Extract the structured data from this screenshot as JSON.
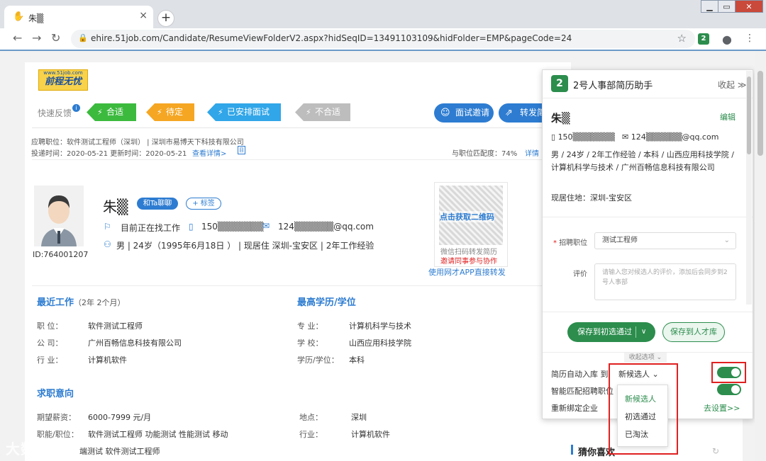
{
  "browser": {
    "tab_title": "朱▒",
    "url": "ehire.51job.com/Candidate/ResumeViewFolderV2.aspx?hidSeqID=13491103109&hidFolder=EMP&pageCode=24",
    "extension_badge": "2"
  },
  "page": {
    "logo": {
      "url_text": "www.51job.com",
      "brand": "前程无忧"
    },
    "quick_feedback": {
      "label": "快速反馈",
      "buttons": [
        "合适",
        "待定",
        "已安排面试",
        "不合适"
      ],
      "colors": [
        "#3cba3e",
        "#f5a623",
        "#31a6e8",
        "#bdbdbd"
      ]
    },
    "actions": {
      "invite": "面试邀请",
      "forward": "转发简"
    },
    "meta": {
      "applied": "应聘职位：软件测试工程师（深圳）  |  深圳市易博天下科技有限公司",
      "posted": "投递时间：2020-05-21    更新时间：2020-05-21",
      "detail_link": "查看详情>",
      "match": "与职位匹配度：74%",
      "match_detail": "详情"
    },
    "candidate": {
      "name": "朱▒",
      "chat": "和Ta聊聊",
      "tag": "+ 标签",
      "id": "ID:764001207",
      "status": "目前正在找工作",
      "phone": "150▒▒▒▒▒▒▒",
      "email": "124▒▒▒▒▒▒@qq.com",
      "info": "男 | 24岁（1995年6月18日 ）  | 现居住 深圳-宝安区 | 2年工作经验"
    },
    "qr": {
      "get": "点击获取二维码",
      "line1": "微信扫码转发简历",
      "line2": "邀请同事参与协作",
      "app": "使用网才APP直接转发"
    },
    "recent_work": {
      "title": "最近工作",
      "duration": "（2年 2个月）",
      "rows": [
        {
          "label": "职    位：",
          "value": "软件测试工程师"
        },
        {
          "label": "公    司：",
          "value": "广州百畅信息科技有限公司"
        },
        {
          "label": "行    业：",
          "value": "计算机软件"
        }
      ]
    },
    "education": {
      "title": "最高学历/学位",
      "rows": [
        {
          "label": "专    业：",
          "value": "计算机科学与技术"
        },
        {
          "label": "学    校：",
          "value": "山西应用科技学院"
        },
        {
          "label": "学历/学位：",
          "value": "本科"
        }
      ]
    },
    "intent": {
      "title": "求职意向",
      "salary_label": "期望薪资：",
      "salary": "6000-7999 元/月",
      "location_label": "地点：",
      "location": "深圳",
      "job_label": "职能/职位：",
      "job": "软件测试工程师   功能测试   性能测试   移动",
      "industry_label": "行业：",
      "industry": "计算机软件",
      "extra": "端测试  软件测试工程师"
    },
    "watermark": "大数跨境",
    "guess": "猜你喜欢"
  },
  "panel": {
    "title": "2号人事部简历助手",
    "fold": "收起 ≫",
    "name": "朱▒",
    "edit": "编辑",
    "phone": "150▒▒▒▒▒▒▒",
    "email": "124▒▒▒▒▒▒@qq.com",
    "info": "男 / 24岁 / 2年工作经验 / 本科 / 山西应用科技学院 / 计算机科学与技术 / 广州百畅信息科技有限公司",
    "address": "现居住地：深圳-宝安区",
    "job_label": "招聘职位",
    "job_value": "测试工程师",
    "eval_label": "评价",
    "eval_placeholder": "请输入您对候选人的评价，添加后会同步到2号人事部",
    "save_btn": "保存到初选通过",
    "lib_btn": "保存到人才库",
    "fold_options": "收起选项",
    "auto_label": "简历自动入库  到",
    "auto_value": "新候选人",
    "smart_match": "智能匹配招聘职位",
    "rebind": "重新绑定企业",
    "go_settings": "去设置>>",
    "dropdown": [
      "新候选人",
      "初选通过",
      "已淘汰"
    ],
    "accent": "#2c8d4d"
  }
}
